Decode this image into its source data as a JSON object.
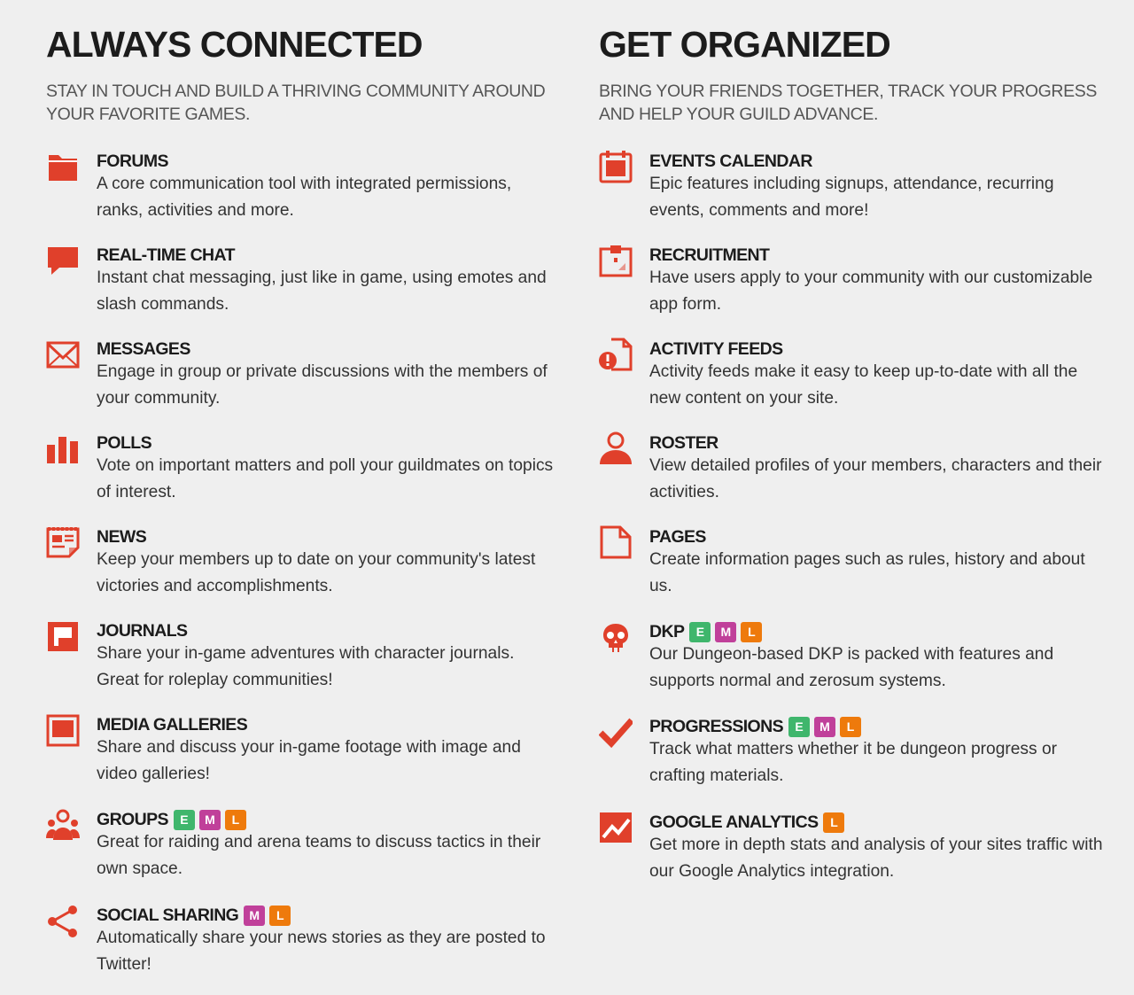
{
  "accent": "#e0402b",
  "badge_colors": {
    "E": "#3fb66c",
    "M": "#c0409a",
    "L": "#ee7a0c"
  },
  "left": {
    "title": "ALWAYS CONNECTED",
    "subtitle": "STAY IN TOUCH AND BUILD A THRIVING COMMUNITY AROUND YOUR FAVORITE GAMES.",
    "features": [
      {
        "icon": "folder-icon",
        "title": "FORUMS",
        "badges": [],
        "desc": "A core communication tool with integrated permissions, ranks, activities and more."
      },
      {
        "icon": "chat-bubble-icon",
        "title": "REAL-TIME CHAT",
        "badges": [],
        "desc": "Instant chat messaging, just like in game, using emotes and slash commands."
      },
      {
        "icon": "envelope-icon",
        "title": "MESSAGES",
        "badges": [],
        "desc": "Engage in group or private discussions with the members of your community."
      },
      {
        "icon": "bar-chart-icon",
        "title": "POLLS",
        "badges": [],
        "desc": "Vote on important matters and poll your guildmates on topics of interest."
      },
      {
        "icon": "newspaper-icon",
        "title": "NEWS",
        "badges": [],
        "desc": "Keep your members up to date on your community's latest victories and accomplishments."
      },
      {
        "icon": "journal-icon",
        "title": "JOURNALS",
        "badges": [],
        "desc": "Share your in-game adventures with character journals. Great for roleplay communities!"
      },
      {
        "icon": "media-frame-icon",
        "title": "MEDIA GALLERIES",
        "badges": [],
        "desc": "Share and discuss your in-game footage with image and video galleries!"
      },
      {
        "icon": "group-icon",
        "title": "GROUPS",
        "badges": [
          "E",
          "M",
          "L"
        ],
        "desc": "Great for raiding and arena teams to discuss tactics in their own space."
      },
      {
        "icon": "share-icon",
        "title": "SOCIAL SHARING",
        "badges": [
          "M",
          "L"
        ],
        "desc": "Automatically share your news stories as they are posted to Twitter!"
      }
    ]
  },
  "right": {
    "title": "GET ORGANIZED",
    "subtitle": "BRING YOUR FRIENDS TOGETHER, TRACK YOUR PROGRESS AND HELP YOUR GUILD ADVANCE.",
    "features": [
      {
        "icon": "calendar-icon",
        "title": "EVENTS CALENDAR",
        "badges": [],
        "desc": "Epic features including signups, attendance, recurring events, comments and more!"
      },
      {
        "icon": "clipboard-icon",
        "title": "RECRUITMENT",
        "badges": [],
        "desc": "Have users apply to your community with our customizable app form."
      },
      {
        "icon": "alert-document-icon",
        "title": "ACTIVITY FEEDS",
        "badges": [],
        "desc": "Activity feeds make it easy to keep up-to-date with all the new content on your site."
      },
      {
        "icon": "user-icon",
        "title": "ROSTER",
        "badges": [],
        "desc": "View detailed profiles of your members, characters and their activities."
      },
      {
        "icon": "page-icon",
        "title": "PAGES",
        "badges": [],
        "desc": "Create information pages such as rules, history and about us."
      },
      {
        "icon": "skull-icon",
        "title": "DKP",
        "badges": [
          "E",
          "M",
          "L"
        ],
        "desc": "Our Dungeon-based DKP is packed with features and supports normal and zerosum systems."
      },
      {
        "icon": "checkmark-icon",
        "title": "PROGRESSIONS",
        "badges": [
          "E",
          "M",
          "L"
        ],
        "desc": "Track what matters whether it be dungeon progress or crafting materials."
      },
      {
        "icon": "analytics-chart-icon",
        "title": "GOOGLE ANALYTICS",
        "badges": [
          "L"
        ],
        "desc": "Get more in depth stats and analysis of your sites traffic with our Google Analytics integration."
      }
    ]
  }
}
